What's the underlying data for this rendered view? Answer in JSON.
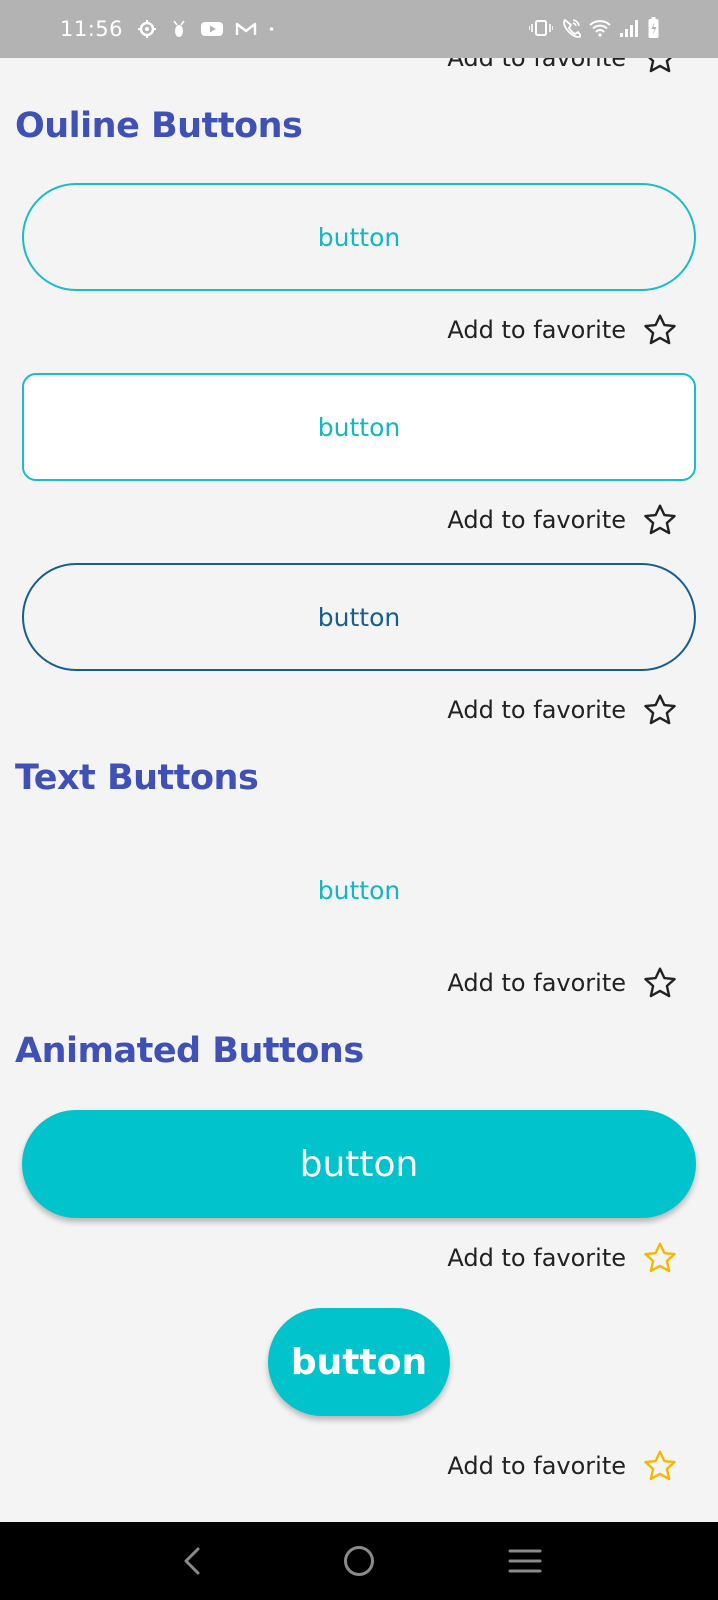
{
  "status_bar": {
    "time": "11:56",
    "left_icons": [
      "settings-gear-icon",
      "bug-icon",
      "youtube-icon",
      "gmail-icon",
      "dot-icon"
    ],
    "right_icons": [
      "vibrate-icon",
      "wifi-call-icon",
      "wifi-icon",
      "signal-icon",
      "battery-charging-icon"
    ]
  },
  "top_fav": {
    "label": "Add to favorite"
  },
  "sections": {
    "outline": {
      "title": "Ouline Buttons",
      "buttons": [
        {
          "label": "button",
          "fav_label": "Add to favorite"
        },
        {
          "label": "button",
          "fav_label": "Add to favorite"
        },
        {
          "label": "button",
          "fav_label": "Add to favorite"
        }
      ]
    },
    "text": {
      "title": "Text Buttons",
      "buttons": [
        {
          "label": "button",
          "fav_label": "Add to favorite"
        }
      ]
    },
    "animated": {
      "title": "Animated Buttons",
      "buttons": [
        {
          "label": "button",
          "fav_label": "Add to favorite",
          "favorited": true
        },
        {
          "label": "button",
          "fav_label": "Add to favorite",
          "favorited": true
        }
      ]
    }
  },
  "colors": {
    "title": "#3f51b5",
    "teal": "#00c3cc",
    "blue_outline": "#175e8e",
    "star_favorited": "#f5b800",
    "star_default": "#222222"
  },
  "nav_bar": {
    "icons": [
      "back-icon",
      "home-icon",
      "recents-icon"
    ]
  }
}
